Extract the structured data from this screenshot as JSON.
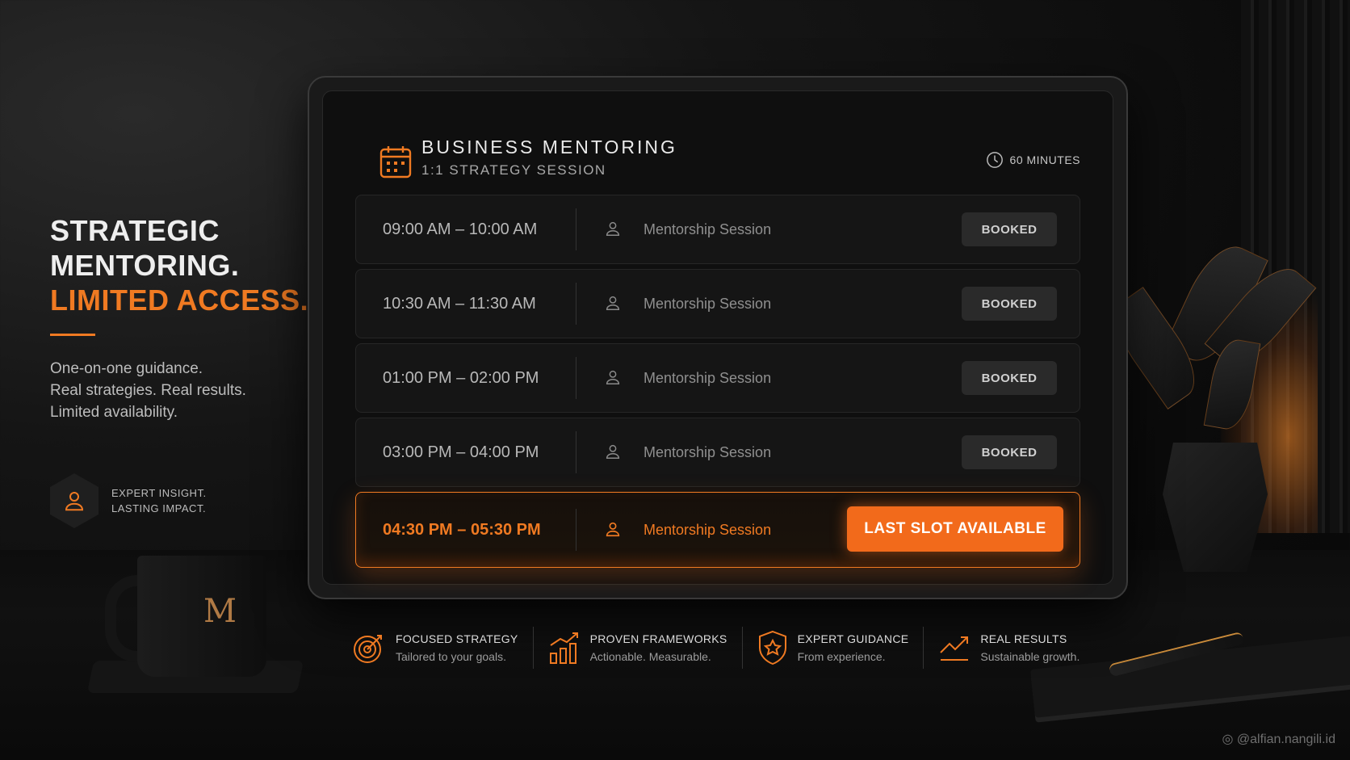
{
  "hero": {
    "line1": "STRATEGIC",
    "line2": "MENTORING.",
    "line3": "LIMITED ACCESS.",
    "sub1": "One-on-one guidance.",
    "sub2": "Real strategies. Real results.",
    "sub3": "Limited availability.",
    "badge_line1": "EXPERT INSIGHT.",
    "badge_line2": "LASTING IMPACT."
  },
  "card": {
    "title": "BUSINESS MENTORING",
    "subtitle": "1:1 STRATEGY SESSION",
    "duration": "60 MINUTES",
    "slots": [
      {
        "time": "09:00 AM – 10:00 AM",
        "label": "Mentorship Session",
        "status": "BOOKED"
      },
      {
        "time": "10:30 AM – 11:30 AM",
        "label": "Mentorship Session",
        "status": "BOOKED"
      },
      {
        "time": "01:00 PM – 02:00 PM",
        "label": "Mentorship Session",
        "status": "BOOKED"
      },
      {
        "time": "03:00 PM – 04:00 PM",
        "label": "Mentorship Session",
        "status": "BOOKED"
      },
      {
        "time": "04:30 PM – 05:30 PM",
        "label": "Mentorship Session",
        "status": "LAST SLOT AVAILABLE"
      }
    ]
  },
  "features": [
    {
      "icon": "target-icon",
      "title": "FOCUSED STRATEGY",
      "sub": "Tailored to your goals."
    },
    {
      "icon": "bar-chart-icon",
      "title": "PROVEN FRAMEWORKS",
      "sub": "Actionable. Measurable."
    },
    {
      "icon": "shield-star-icon",
      "title": "EXPERT GUIDANCE",
      "sub": "From experience."
    },
    {
      "icon": "trend-up-icon",
      "title": "REAL RESULTS",
      "sub": "Sustainable growth."
    }
  ],
  "mug_logo": "M",
  "credit": "@alfian.nangili.id",
  "colors": {
    "accent": "#f07a22",
    "background": "#0b0b0b",
    "booked": "#2a2a2a"
  }
}
